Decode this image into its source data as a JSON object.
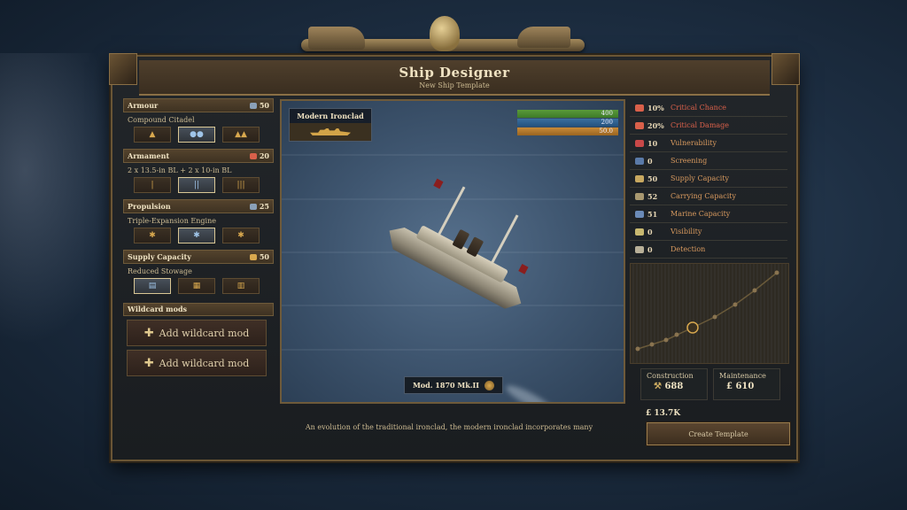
{
  "window": {
    "title": "Ship Designer",
    "subtitle": "New Ship Template"
  },
  "sections": {
    "armour": {
      "title": "Armour",
      "value": "50",
      "option": "Compound Citadel",
      "options": [
        "▲",
        "●●",
        "▲▲"
      ],
      "selected": 1,
      "color": "#8aa0b8"
    },
    "armament": {
      "title": "Armament",
      "value": "20",
      "option": "2 x 13.5-in BL + 2 x 10-in BL",
      "options": [
        "|",
        "||",
        "|||"
      ],
      "selected": 1,
      "color": "#d9604a"
    },
    "propulsion": {
      "title": "Propulsion",
      "value": "25",
      "option": "Triple-Expansion Engine",
      "options": [
        "✱",
        "✱",
        "✱"
      ],
      "selected": 1,
      "color": "#8aa0b8"
    },
    "supply": {
      "title": "Supply Capacity",
      "value": "50",
      "option": "Reduced Stowage",
      "options": [
        "▤",
        "▦",
        "▥"
      ],
      "selected": 0,
      "color": "#d8a84e"
    }
  },
  "wildcard": {
    "title": "Wildcard mods",
    "buttons": [
      "Add wildcard mod",
      "Add wildcard mod"
    ]
  },
  "viewport": {
    "ship_class": "Modern Ironclad",
    "model": "Mod. 1870 Mk.II",
    "bars": [
      {
        "value": "400",
        "fill": 1.0,
        "color": "green"
      },
      {
        "value": "200",
        "fill": 1.0,
        "color": "blue"
      },
      {
        "value": "50.0",
        "fill": 1.0,
        "color": "orange"
      }
    ]
  },
  "description": "An evolution of the traditional ironclad, the modern ironclad incorporates many",
  "stats": [
    {
      "value": "10%",
      "label": "Critical Chance",
      "critical": true,
      "icon": "#d9604a"
    },
    {
      "value": "20%",
      "label": "Critical Damage",
      "critical": true,
      "icon": "#d9604a"
    },
    {
      "value": "10",
      "label": "Vulnerability",
      "critical": false,
      "icon": "#c84848"
    },
    {
      "value": "0",
      "label": "Screening",
      "critical": false,
      "icon": "#5a7aa8"
    },
    {
      "value": "50",
      "label": "Supply Capacity",
      "critical": false,
      "icon": "#c8a860"
    },
    {
      "value": "52",
      "label": "Carrying Capacity",
      "critical": false,
      "icon": "#a89870"
    },
    {
      "value": "51",
      "label": "Marine Capacity",
      "critical": false,
      "icon": "#6a8ab8"
    },
    {
      "value": "0",
      "label": "Visibility",
      "critical": false,
      "icon": "#c8b870"
    },
    {
      "value": "0",
      "label": "Detection",
      "critical": false,
      "icon": "#b8b098"
    }
  ],
  "costs": {
    "construction_label": "Construction",
    "construction_value": "688",
    "maintenance_label": "Maintenance",
    "maintenance_value": "£ 610",
    "total": "£ 13.7K"
  },
  "create_button": "Create Template"
}
